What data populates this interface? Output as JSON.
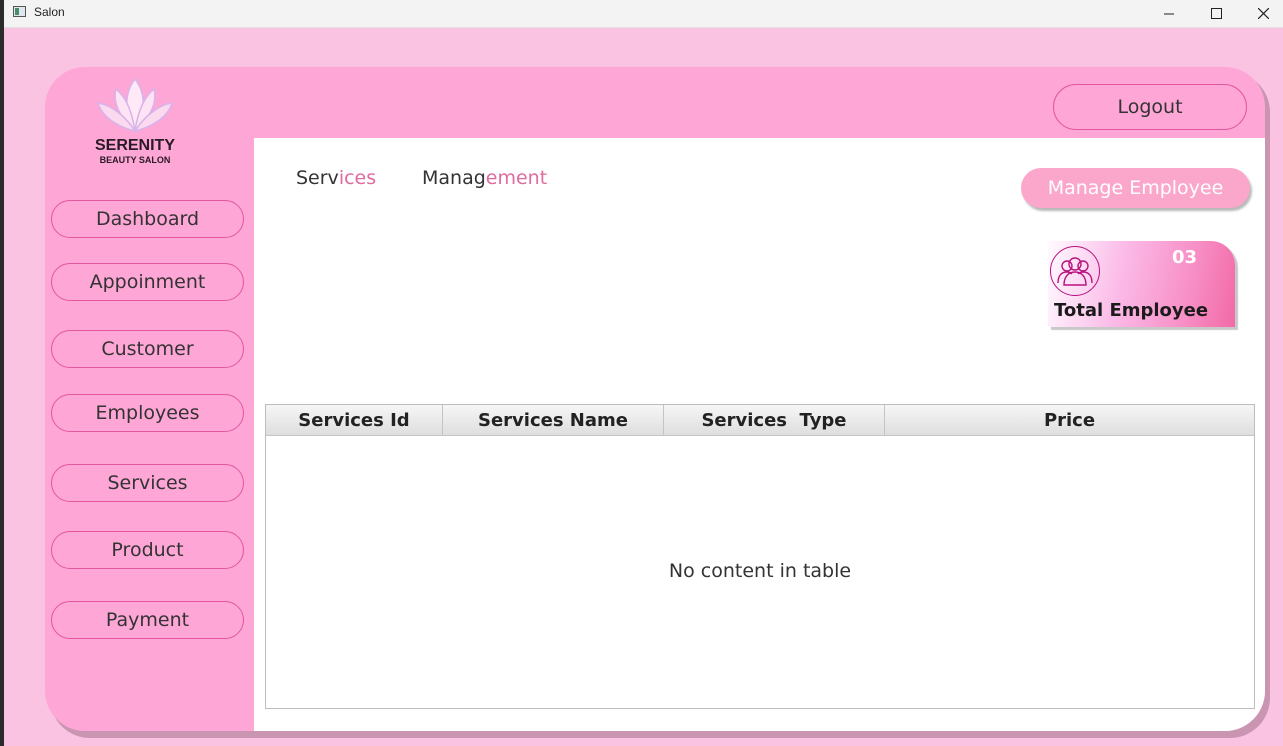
{
  "window": {
    "title": "Salon"
  },
  "logo": {
    "title": "SERENITY",
    "subtitle": "BEAUTY SALON"
  },
  "sidebar": {
    "items": [
      {
        "label": "Dashboard"
      },
      {
        "label": "Appoinment"
      },
      {
        "label": "Customer"
      },
      {
        "label": "Employees"
      },
      {
        "label": "Services"
      },
      {
        "label": "Product"
      },
      {
        "label": "Payment"
      }
    ]
  },
  "header": {
    "logout_label": "Logout"
  },
  "tabs": [
    {
      "label_a": "Serv",
      "label_b": "ices"
    },
    {
      "label_a": "Manag",
      "label_b": "ement"
    }
  ],
  "actions": {
    "manage_label": "Manage Employee"
  },
  "stat": {
    "value": "03",
    "label": "Total Employee",
    "icon": "users-icon"
  },
  "table": {
    "columns": [
      "Services Id",
      "Services Name",
      "Services  Type",
      "Price"
    ],
    "rows": [],
    "empty_text": "No content in table"
  },
  "colors": {
    "background": "#fbc3e2",
    "panel": "#fea6d6",
    "accent": "#e2579f",
    "button_fill": "#fba7cc"
  }
}
